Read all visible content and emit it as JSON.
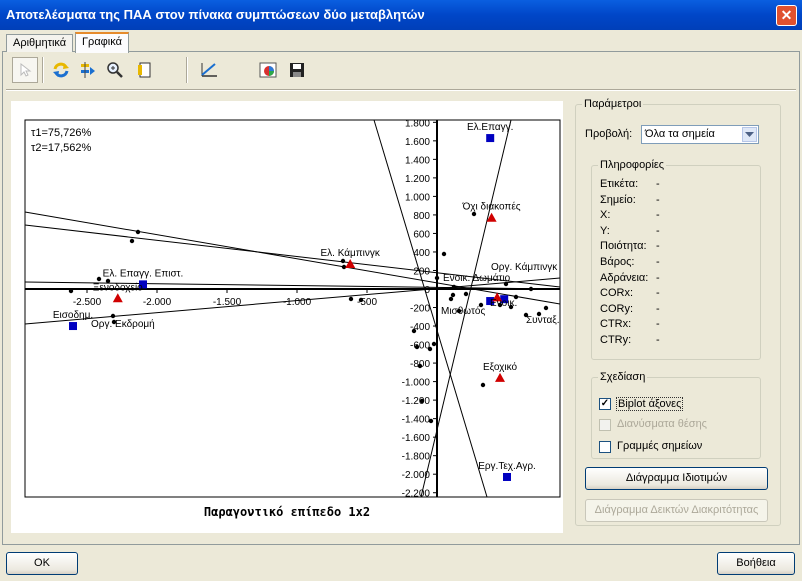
{
  "window": {
    "title": "Αποτελέσματα της ΠΑΑ στον πίνακα συμπτώσεων δύο μεταβλητών",
    "close_label": "✕"
  },
  "tabs": [
    {
      "label": "Αριθμητικά",
      "active": false
    },
    {
      "label": "Γραφικά",
      "active": true
    }
  ],
  "toolbar": {
    "icons": [
      "cursor-icon",
      "refresh-icon",
      "move-icon",
      "zoom-icon",
      "page-icon",
      "axes-icon",
      "chart-color-icon",
      "save-icon"
    ]
  },
  "chart": {
    "title": "Παραγοντικό επίπεδο 1x2",
    "inertia_1": "τ1=75,726%",
    "inertia_2": "τ2=17,562%"
  },
  "chart_data": {
    "type": "scatter",
    "title": "Παραγοντικό επίπεδο 1x2",
    "xlabel": "",
    "ylabel": "",
    "xlim": [
      -2750,
      1550
    ],
    "ylim": [
      -2200,
      1800
    ],
    "x_ticks": [
      -2500,
      -2000,
      -1500,
      -1000,
      -500
    ],
    "x_tick_labels": [
      "-2.500",
      "-2.000",
      "-1.500",
      "-1.000",
      "-500"
    ],
    "y_ticks": [
      1800,
      1600,
      1400,
      1200,
      1000,
      800,
      600,
      400,
      200,
      0,
      -200,
      -400,
      -600,
      -800,
      -1000,
      -1200,
      -1400,
      -1600,
      -1800,
      -2000,
      -2200
    ],
    "y_tick_labels": [
      "1.800",
      "1.600",
      "1.400",
      "1.200",
      "1.000",
      "800",
      "600",
      "400",
      "200",
      "0",
      "-200",
      "-400",
      "-600",
      "-800",
      "-1.000",
      "-1.200",
      "-1.400",
      "-1.600",
      "-1.800",
      "-2.000",
      "-2.200"
    ],
    "series": [
      {
        "marker": "square",
        "color": "#0000c0",
        "points": [
          {
            "label": "Ελ.Επαγγ.",
            "x": 380,
            "y": 1630
          },
          {
            "label": "Ελ. Επαγγ. Επιστ.",
            "x": -2100,
            "y": 50
          },
          {
            "label": "Εισοδημ.",
            "x": -2600,
            "y": -400
          },
          {
            "label": "Εργ.Τεχ.Αγρ.",
            "x": 500,
            "y": -2030
          },
          {
            "label": "",
            "x": 380,
            "y": -130
          },
          {
            "label": "",
            "x": 480,
            "y": -110
          }
        ]
      },
      {
        "marker": "triangle",
        "color": "#d00000",
        "points": [
          {
            "label": "Όχι διακοπές",
            "x": 390,
            "y": 770
          },
          {
            "label": "Ελ. Κάμπινγκ",
            "x": -620,
            "y": 270
          },
          {
            "label": "Ξενοδοχείο",
            "x": -2280,
            "y": -100
          },
          {
            "label": "Εξοχικό",
            "x": 450,
            "y": -960
          },
          {
            "label": "",
            "x": 430,
            "y": -90
          }
        ]
      }
    ],
    "text_labels": [
      "Οργ. Κάμπινγκ",
      "Ενοικ. Δωμάτιο",
      "Μισθωτός",
      "Ενοικ.",
      "Συνταξ.",
      "Οργ. Εκδρομή"
    ]
  },
  "params": {
    "legend": "Παράμετροι",
    "view_label": "Προβολή:",
    "view_value": "Όλα τα σημεία",
    "info_legend": "Πληροφορίες",
    "info_rows": [
      {
        "label": "Ετικέτα:",
        "value": "-"
      },
      {
        "label": "Σημείο:",
        "value": "-"
      },
      {
        "label": "X:",
        "value": "-"
      },
      {
        "label": "Y:",
        "value": "-"
      },
      {
        "label": "Ποιότητα:",
        "value": "-"
      },
      {
        "label": "Βάρος:",
        "value": "-"
      },
      {
        "label": "Αδράνεια:",
        "value": "-"
      },
      {
        "label": "CORx:",
        "value": "-"
      },
      {
        "label": "CORy:",
        "value": "-"
      },
      {
        "label": "CTRx:",
        "value": "-"
      },
      {
        "label": "CTRy:",
        "value": "-"
      }
    ],
    "draw_legend": "Σχεδίαση",
    "options": [
      {
        "label": "Biplot άξονες",
        "checked": true,
        "enabled": true
      },
      {
        "label": "Διανύσματα θέσης",
        "checked": false,
        "enabled": false
      },
      {
        "label": "Γραμμές σημείων",
        "checked": false,
        "enabled": true
      }
    ],
    "eigen_button": "Διάγραμμα Ιδιοτιμών",
    "discrim_button": "Διάγραμμα Δεικτών Διακριτότητας"
  },
  "footer": {
    "ok_label": "OK",
    "help_label": "Βοήθεια"
  }
}
